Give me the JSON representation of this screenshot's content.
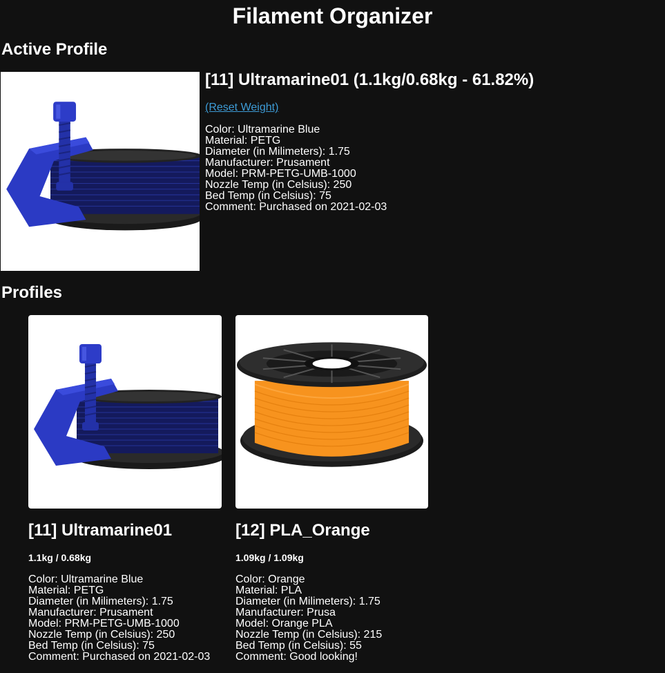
{
  "page": {
    "title": "Filament Organizer"
  },
  "active_profile": {
    "heading": "Active Profile",
    "title": "[11] Ultramarine01 (1.1kg/0.68kg - 61.82%)",
    "reset_label": "(Reset Weight)",
    "image_icon": "blue-filament-spool-with-clamp",
    "details": [
      "Color: Ultramarine Blue",
      "Material: PETG",
      "Diameter (in Milimeters): 1.75",
      "Manufacturer: Prusament",
      "Model: PRM-PETG-UMB-1000",
      "Nozzle Temp (in Celsius): 250",
      "Bed Temp (in Celsius): 75",
      "Comment: Purchased on 2021-02-03"
    ]
  },
  "profiles": {
    "heading": "Profiles",
    "items": [
      {
        "title": "[11] Ultramarine01",
        "weight": "1.1kg / 0.68kg",
        "image_icon": "blue-filament-spool-with-clamp",
        "details": [
          "Color: Ultramarine Blue",
          "Material: PETG",
          "Diameter (in Milimeters): 1.75",
          "Manufacturer: Prusament",
          "Model: PRM-PETG-UMB-1000",
          "Nozzle Temp (in Celsius): 250",
          "Bed Temp (in Celsius): 75",
          "Comment: Purchased on 2021-02-03"
        ]
      },
      {
        "title": "[12] PLA_Orange",
        "weight": "1.09kg / 1.09kg",
        "image_icon": "orange-filament-spool",
        "details": [
          "Color: Orange",
          "Material: PLA",
          "Diameter (in Milimeters): 1.75",
          "Manufacturer: Prusa",
          "Model: Orange PLA",
          "Nozzle Temp (in Celsius): 215",
          "Bed Temp (in Celsius): 55",
          "Comment: Good looking!"
        ]
      }
    ]
  },
  "colors": {
    "background": "#111111",
    "text": "#ffffff",
    "link": "#3d9bd6",
    "ultramarine": "#1f2b8f",
    "orange_filament": "#f7931e"
  }
}
